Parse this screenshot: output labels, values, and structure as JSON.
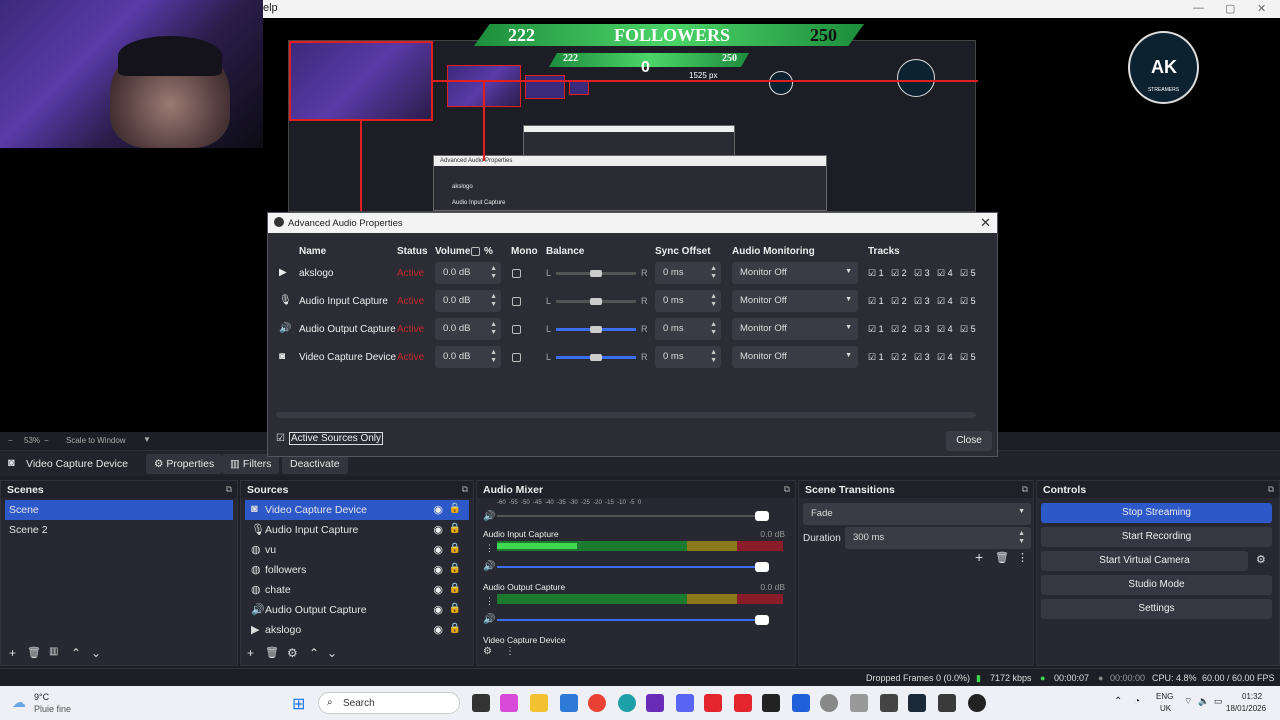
{
  "preview": {
    "help_menu": "elp",
    "followers": {
      "min": "222",
      "label": "FOLLOWERS",
      "max": "250"
    },
    "nested_followers": {
      "min": "222",
      "max": "250",
      "value": "0"
    },
    "nested_readout": "1525 px",
    "nested_dialog_title": "Advanced Audio Properties",
    "nested_rows": [
      "akslogo",
      "Audio Input Capture"
    ],
    "logo_text": "AK",
    "logo_caption": "STREAMERS"
  },
  "zoom": {
    "level": "53%",
    "mode": "Scale to Window"
  },
  "source_toolbar": {
    "source_name": "Video Capture Device",
    "properties_label": "Properties",
    "filters_label": "Filters",
    "deactivate_label": "Deactivate"
  },
  "scenes": {
    "title": "Scenes",
    "items": [
      "Scene",
      "Scene 2"
    ]
  },
  "sources": {
    "title": "Sources",
    "items": [
      {
        "label": "Video Capture Device",
        "icon": "camera-icon"
      },
      {
        "label": "Audio Input Capture",
        "icon": "microphone-icon"
      },
      {
        "label": "vu",
        "icon": "globe-icon"
      },
      {
        "label": "followers",
        "icon": "globe-icon"
      },
      {
        "label": "chate",
        "icon": "globe-icon"
      },
      {
        "label": "Audio Output Capture",
        "icon": "speaker-icon"
      },
      {
        "label": "akslogo",
        "icon": "play-icon"
      }
    ]
  },
  "mixer": {
    "title": "Audio Mixer",
    "scale": [
      "-60",
      "-55",
      "-50",
      "-45",
      "-40",
      "-35",
      "-30",
      "-25",
      "-20",
      "-15",
      "-10",
      "-5",
      "0"
    ],
    "tracks": [
      {
        "name": "Audio Input Capture",
        "db": "0.0 dB",
        "level": 0.28
      },
      {
        "name": "Audio Output Capture",
        "db": "0.0 dB",
        "level": 0.0
      },
      {
        "name": "Video Capture Device",
        "db": ""
      }
    ]
  },
  "transitions": {
    "title": "Scene Transitions",
    "selected": "Fade",
    "duration_label": "Duration",
    "duration_value": "300 ms"
  },
  "controls": {
    "title": "Controls",
    "stop_streaming": "Stop Streaming",
    "start_recording": "Start Recording",
    "start_virtual_camera": "Start Virtual Camera",
    "studio_mode": "Studio Mode",
    "settings": "Settings"
  },
  "status": {
    "dropped_frames": "Dropped Frames 0 (0.0%)",
    "bitrate": "7172 kbps",
    "stream_time": "00:00:07",
    "rec_time": "00:00:00",
    "cpu": "CPU: 4.8%",
    "fps": "60.00 / 60.00 FPS"
  },
  "dialog": {
    "title": "Advanced Audio Properties",
    "headers": {
      "name": "Name",
      "status": "Status",
      "volume": "Volume",
      "percent": "%",
      "mono": "Mono",
      "balance": "Balance",
      "sync": "Sync Offset",
      "monitoring": "Audio Monitoring",
      "tracks": "Tracks"
    },
    "rows": [
      {
        "name": "akslogo",
        "icon": "play-icon",
        "status": "Active",
        "volume": "0.0 dB",
        "sync": "0 ms",
        "monitoring": "Monitor Off",
        "balance": 0.5
      },
      {
        "name": "Audio Input Capture",
        "icon": "microphone-icon",
        "status": "Active",
        "volume": "0.0 dB",
        "sync": "0 ms",
        "monitoring": "Monitor Off",
        "balance": 0.5
      },
      {
        "name": "Audio Output Capture",
        "icon": "speaker-icon",
        "status": "Active",
        "volume": "0.0 dB",
        "sync": "0 ms",
        "monitoring": "Monitor Off",
        "balance": 0.5
      },
      {
        "name": "Video Capture Device",
        "icon": "camera-icon",
        "status": "Active",
        "volume": "0.0 dB",
        "sync": "0 ms",
        "monitoring": "Monitor Off",
        "balance": 0.5
      }
    ],
    "track_numbers": [
      "1",
      "2",
      "3",
      "4",
      "5"
    ],
    "balance_left": "L",
    "balance_right": "R",
    "active_sources_only": "Active Sources Only",
    "close_label": "Close"
  },
  "taskbar": {
    "weather_temp": "9°C",
    "weather_desc": "Pluie fine",
    "search_placeholder": "Search",
    "lang": "ENG",
    "region": "UK",
    "time": "01:32",
    "date": "18/01/2026"
  },
  "colors": {
    "accent": "#2d58c8",
    "status_active": "#c0282e",
    "follower_green": "#4cd468"
  }
}
